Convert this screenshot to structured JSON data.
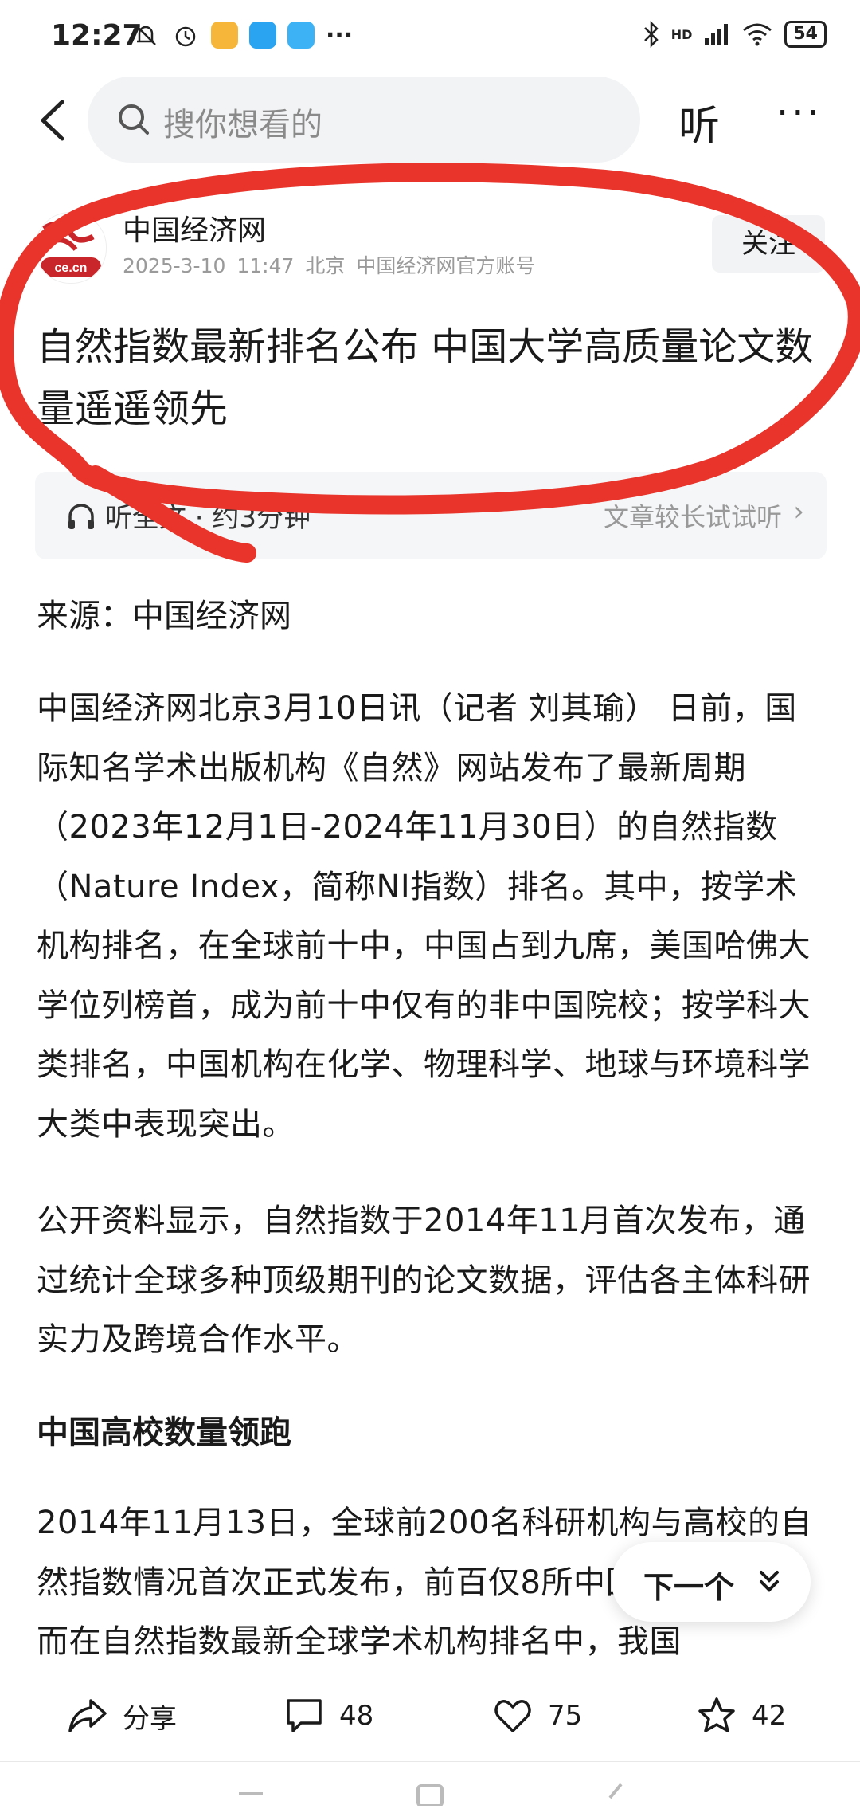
{
  "status_bar": {
    "time": "12:27",
    "network": "HD",
    "battery": "54"
  },
  "search": {
    "placeholder": "搜你想看的"
  },
  "top_actions": {
    "listen": "听",
    "more": "···"
  },
  "author": {
    "name": "中国经济网",
    "logo_text": "ce.cn",
    "date": "2025-3-10",
    "time": "11:47",
    "location": "北京",
    "account_type": "中国经济网官方账号",
    "follow_label": "关注"
  },
  "article": {
    "title": "自然指数最新排名公布 中国大学高质量论文数量遥遥领先",
    "listen_label": "听全文 · 约3分钟",
    "listen_hint": "文章较长试试听",
    "source": "来源：中国经济网",
    "paragraphs": [
      "中国经济网北京3月10日讯（记者 刘其瑜） 日前，国际知名学术出版机构《自然》网站发布了最新周期（2023年12月1日-2024年11月30日）的自然指数（Nature Index，简称NI指数）排名。其中，按学术机构排名，在全球前十中，中国占到九席，美国哈佛大学位列榜首，成为前十中仅有的非中国院校；按学科大类排名，中国机构在化学、物理科学、地球与环境科学大类中表现突出。",
      "公开资料显示，自然指数于2014年11月首次发布，通过统计全球多种顶级期刊的论文数据，评估各主体科研实力及跨境合作水平。"
    ],
    "section_title": "中国高校数量领跑",
    "paragraph_3": "2014年11月13日，全球前200名科研机构与高校的自然指数情况首次正式发布，前百仅8所中国高校上榜。而在自然指数最新全球学术机构排名中，我国"
  },
  "next_button": {
    "label": "下一个"
  },
  "bottom_bar": {
    "share_label": "分享",
    "comment_count": "48",
    "like_count": "75",
    "favorite_count": "42"
  },
  "colors": {
    "annotation": "#e8342a",
    "accent": "#1a1a1a",
    "muted": "#9a9a9a"
  },
  "icons": [
    "back-arrow-icon",
    "search-icon",
    "headphones-icon",
    "share-icon",
    "comment-icon",
    "heart-icon",
    "star-icon",
    "double-chevron-down-icon"
  ]
}
